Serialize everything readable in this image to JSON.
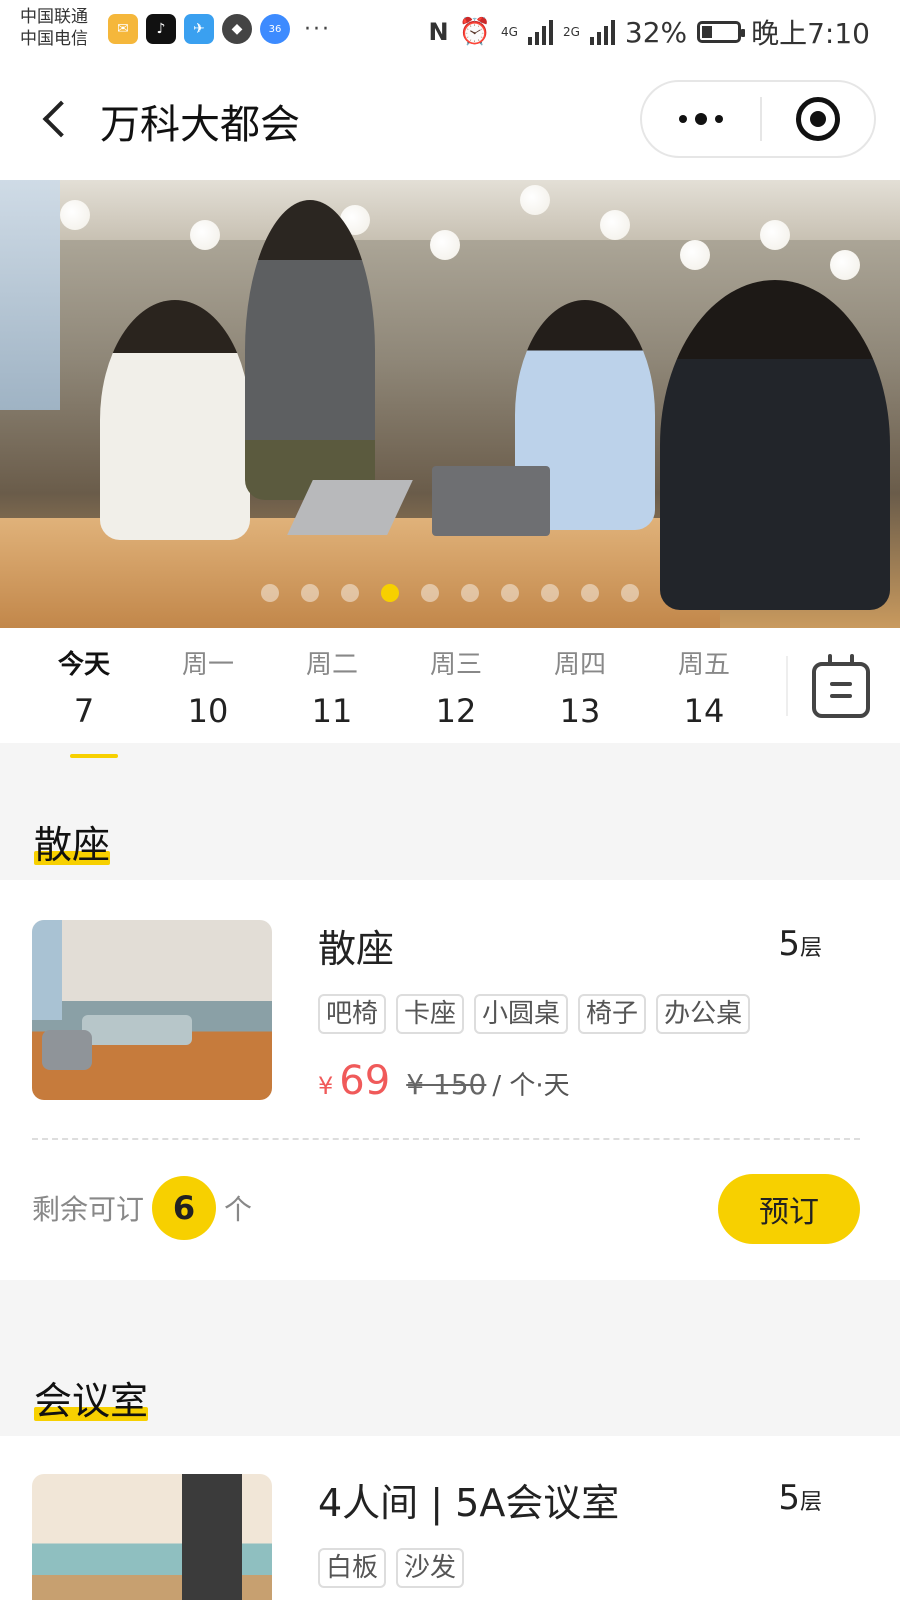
{
  "status_bar": {
    "carrier1": "中国联通",
    "carrier2": "中国电信",
    "more": "···",
    "net1": "4G",
    "net2": "2G",
    "battery": "32%",
    "time": "晚上7:10"
  },
  "navbar": {
    "title": "万科大都会"
  },
  "banner": {
    "slide_count": 10,
    "active_slide": 4
  },
  "dates": [
    {
      "weekday": "今天",
      "day": "7"
    },
    {
      "weekday": "周一",
      "day": "10"
    },
    {
      "weekday": "周二",
      "day": "11"
    },
    {
      "weekday": "周三",
      "day": "12"
    },
    {
      "weekday": "周四",
      "day": "13"
    },
    {
      "weekday": "周五",
      "day": "14"
    }
  ],
  "sections": {
    "open_seat": {
      "title": "散座",
      "card": {
        "name": "散座",
        "floor_num": "5",
        "floor_unit": "层",
        "tags": [
          "吧椅",
          "卡座",
          "小圆桌",
          "椅子",
          "办公桌"
        ],
        "currency": "¥",
        "price": "69",
        "old_price": "¥ 150",
        "unit": "/ 个·天",
        "remain_prefix": "剩余可订",
        "remain_count": "6",
        "remain_suffix": "个",
        "book_label": "预订"
      }
    },
    "meeting": {
      "title": "会议室",
      "card": {
        "name": "4人间 | 5A会议室",
        "floor_num": "5",
        "floor_unit": "层",
        "tags": [
          "白板",
          "沙发"
        ]
      }
    }
  },
  "colors": {
    "accent": "#f7d000",
    "price": "#f05a5a"
  }
}
